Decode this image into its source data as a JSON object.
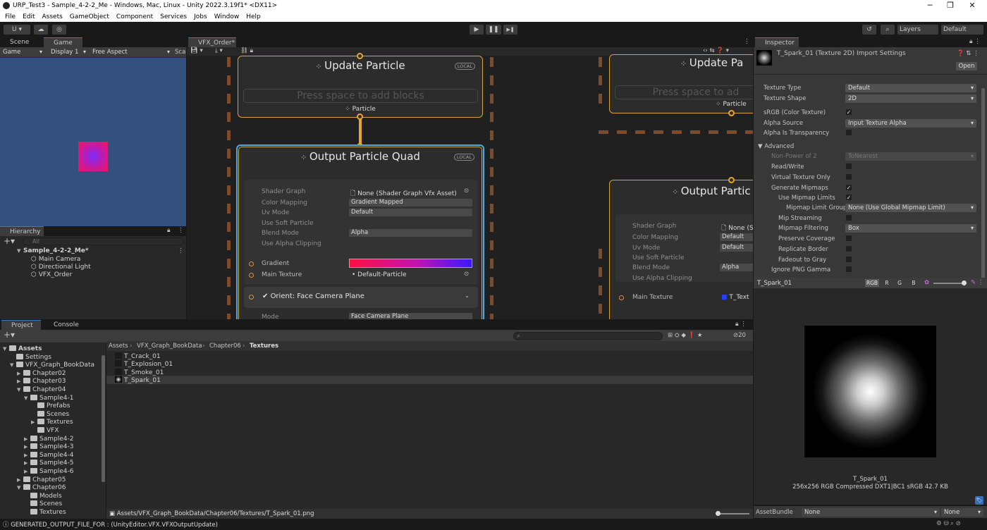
{
  "window": {
    "title": "URP_Test3 - Sample_4-2-2_Me - Windows, Mac, Linux - Unity 2022.3.19f1* <DX11>",
    "min": "─",
    "max": "❐",
    "close": "✕"
  },
  "menu": [
    "File",
    "Edit",
    "Assets",
    "GameObject",
    "Component",
    "Services",
    "Jobs",
    "Window",
    "Help"
  ],
  "toolbar": {
    "account": "U ▾",
    "play": "▶",
    "pause": "❚❚",
    "step": "▶❚",
    "layers": "Layers",
    "layout": "Default"
  },
  "scene": {
    "tab_scene": "Scene",
    "tab_game": "Game",
    "game_mode": "Game",
    "display": "Display 1",
    "aspect": "Free Aspect",
    "scale": "Sca"
  },
  "hierarchy": {
    "tab": "Hierarchy",
    "search": "All",
    "scene": "Sample_4-2-2_Me*",
    "items": [
      "Main Camera",
      "Directional Light",
      "VFX_Order"
    ]
  },
  "vfx": {
    "tab": "VFX_Order*",
    "update_title": "Update Particle",
    "local": "LOCAL",
    "placeholder": "Press space to add blocks",
    "particle_label": "Particle",
    "output_title": "Output Particle Quad",
    "props": [
      {
        "label": "Shader Graph",
        "value": "None (Shader Graph Vfx Asset)"
      },
      {
        "label": "Color Mapping",
        "value": "Gradient Mapped"
      },
      {
        "label": "Uv Mode",
        "value": "Default"
      },
      {
        "label": "Use Soft Particle",
        "value": ""
      },
      {
        "label": "Blend Mode",
        "value": "Alpha"
      },
      {
        "label": "Use Alpha Clipping",
        "value": ""
      }
    ],
    "gradient_label": "Gradient",
    "main_texture_label": "Main Texture",
    "main_texture_value": "Default-Particle",
    "orient_label": "Orient: Face Camera Plane",
    "mode_label": "Mode",
    "mode_value": "Face Camera Plane",
    "right_update_title": "Update Pa",
    "right_placeholder": "Press space to ad",
    "right_particle": "Particle",
    "right_output_title": "Output Partic",
    "right_props": [
      {
        "label": "Shader Graph",
        "value": "None (S"
      },
      {
        "label": "Color Mapping",
        "value": "Default"
      },
      {
        "label": "Uv Mode",
        "value": "Default"
      },
      {
        "label": "Use Soft Particle",
        "value": ""
      },
      {
        "label": "Blend Mode",
        "value": "Alpha"
      },
      {
        "label": "Use Alpha Clipping",
        "value": ""
      }
    ],
    "right_main_texture": "Main Texture",
    "right_main_texture_value": "T_Text"
  },
  "inspector": {
    "tab": "Inspector",
    "asset_title": "T_Spark_01 (Texture 2D) Import Settings",
    "open": "Open",
    "fields": [
      {
        "label": "Texture Type",
        "value": "Default"
      },
      {
        "label": "Texture Shape",
        "value": "2D"
      }
    ],
    "srgb": "sRGB (Color Texture)",
    "alpha_source": "Alpha Source",
    "alpha_source_value": "Input Texture Alpha",
    "alpha_transparency": "Alpha Is Transparency",
    "advanced": "Advanced",
    "npot": "Non-Power of 2",
    "npot_value": "ToNearest",
    "read_write": "Read/Write",
    "virtual_texture": "Virtual Texture Only",
    "gen_mipmaps": "Generate Mipmaps",
    "use_mip_limits": "Use Mipmap Limits",
    "mip_limit_group": "Mipmap Limit Group",
    "mip_limit_group_value": "None (Use Global Mipmap Limit)",
    "mip_streaming": "Mip Streaming",
    "mip_filtering": "Mipmap Filtering",
    "mip_filtering_value": "Box",
    "preserve_coverage": "Preserve Coverage",
    "replicate_border": "Replicate Border",
    "fadeout": "Fadeout to Gray",
    "ignore_png": "Ignore PNG Gamma",
    "preview_name": "T_Spark_01",
    "channels": [
      "RGB",
      "R",
      "G",
      "B"
    ],
    "preview_caption": "T_Spark_01",
    "preview_info": "256x256  RGB Compressed DXT1|BC1 sRGB  42.7 KB",
    "asset_bundle": "AssetBundle",
    "asset_bundle_value": "None",
    "asset_bundle_variant": "None"
  },
  "project": {
    "tab_project": "Project",
    "tab_console": "Console",
    "breadcrumb": [
      "Assets",
      "VFX_Graph_BookData",
      "Chapter06",
      "Textures"
    ],
    "hidden_count": "20",
    "tree": [
      {
        "label": "Assets",
        "level": 0,
        "arrow": "▼",
        "bold": true
      },
      {
        "label": "Settings",
        "level": 1,
        "arrow": ""
      },
      {
        "label": "VFX_Graph_BookData",
        "level": 1,
        "arrow": "▼"
      },
      {
        "label": "Chapter02",
        "level": 2,
        "arrow": "▶"
      },
      {
        "label": "Chapter03",
        "level": 2,
        "arrow": "▶"
      },
      {
        "label": "Chapter04",
        "level": 2,
        "arrow": "▼"
      },
      {
        "label": "Sample4-1",
        "level": 3,
        "arrow": "▼"
      },
      {
        "label": "Prefabs",
        "level": 4,
        "arrow": ""
      },
      {
        "label": "Scenes",
        "level": 4,
        "arrow": ""
      },
      {
        "label": "Textures",
        "level": 4,
        "arrow": "▶"
      },
      {
        "label": "VFX",
        "level": 4,
        "arrow": ""
      },
      {
        "label": "Sample4-2",
        "level": 3,
        "arrow": "▶"
      },
      {
        "label": "Sample4-3",
        "level": 3,
        "arrow": "▶"
      },
      {
        "label": "Sample4-4",
        "level": 3,
        "arrow": "▶"
      },
      {
        "label": "Sample4-5",
        "level": 3,
        "arrow": "▶"
      },
      {
        "label": "Sample4-6",
        "level": 3,
        "arrow": "▶"
      },
      {
        "label": "Chapter05",
        "level": 2,
        "arrow": "▶"
      },
      {
        "label": "Chapter06",
        "level": 2,
        "arrow": "▼"
      },
      {
        "label": "Models",
        "level": 3,
        "arrow": ""
      },
      {
        "label": "Scenes",
        "level": 3,
        "arrow": ""
      },
      {
        "label": "Textures",
        "level": 3,
        "arrow": ""
      }
    ],
    "files": [
      "T_Crack_01",
      "T_Explosion_01",
      "T_Smoke_01",
      "T_Spark_01"
    ],
    "path": "Assets/VFX_Graph_BookData/Chapter06/Textures/T_Spark_01.png"
  },
  "status": {
    "text": "GENERATED_OUTPUT_FILE_FOR : (UnityEditor.VFX.VFXOutputUpdate)"
  }
}
